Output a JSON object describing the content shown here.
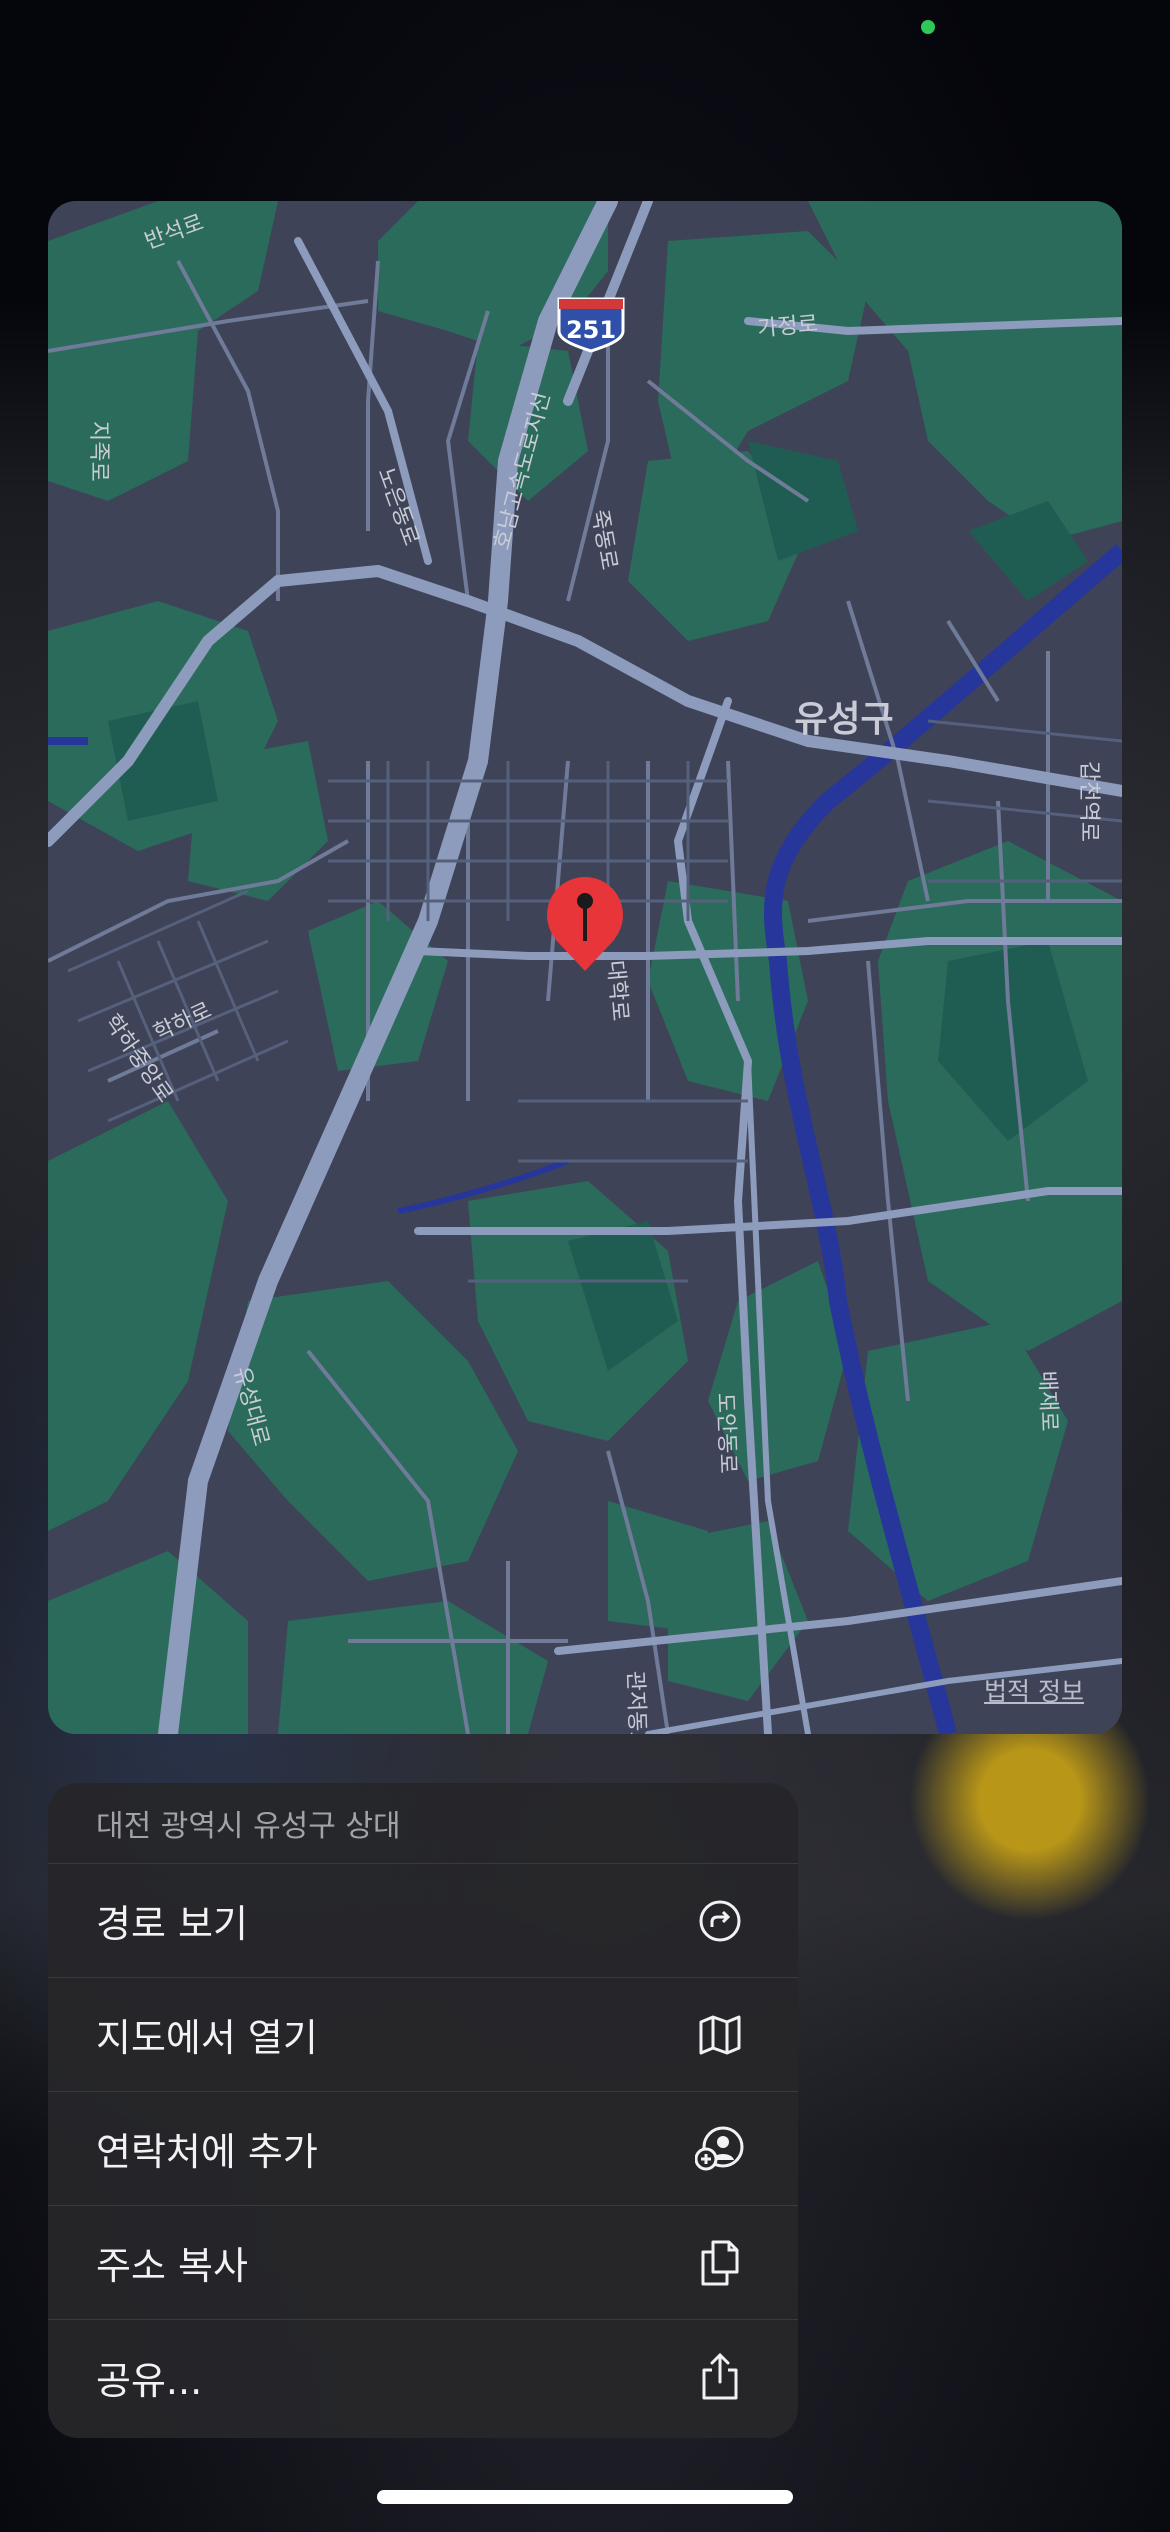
{
  "map": {
    "district_label": "유성구",
    "route_shield": "251",
    "road_labels": [
      "반석로",
      "지족로",
      "노은동로",
      "호남고속도로지선",
      "죽동로",
      "가정로",
      "갑천역로",
      "학하로",
      "학하중앙로",
      "유성대로",
      "도안동로",
      "관저동로",
      "배재로",
      "대학로"
    ],
    "legal_link": "법적 정보",
    "colors": {
      "land": "#3f4357",
      "park": "#2a6b5b",
      "water": "#27369a",
      "road": "#8d9bbd",
      "pin": "#e8353a"
    }
  },
  "menu": {
    "address": "대전 광역시 유성구 상대",
    "items": [
      {
        "label": "경로 보기",
        "icon": "directions-icon"
      },
      {
        "label": "지도에서 열기",
        "icon": "map-icon"
      },
      {
        "label": "연락처에 추가",
        "icon": "add-contact-icon"
      },
      {
        "label": "주소 복사",
        "icon": "copy-icon"
      },
      {
        "label": "공유...",
        "icon": "share-icon"
      }
    ]
  }
}
